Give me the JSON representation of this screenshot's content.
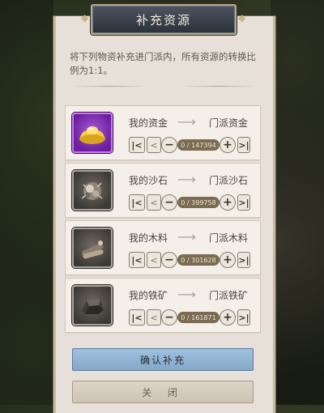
{
  "dialog": {
    "title": "补充资源",
    "description": "将下列物资补充进门派内，所有资源的转换比例为1:1。"
  },
  "resources": [
    {
      "from": "我的资金",
      "to": "门派资金",
      "value": "0 / 147394",
      "icon": "gold-ingot-icon"
    },
    {
      "from": "我的沙石",
      "to": "门派沙石",
      "value": "0 / 399758",
      "icon": "sand-stone-icon"
    },
    {
      "from": "我的木料",
      "to": "门派木料",
      "value": "0 / 301628",
      "icon": "wood-logs-icon"
    },
    {
      "from": "我的铁矿",
      "to": "门派铁矿",
      "value": "0 / 161871",
      "icon": "iron-ore-icon"
    }
  ],
  "buttons": {
    "confirm": "确认补充",
    "close": "关 闭"
  },
  "glyphs": {
    "first": "|<",
    "prev": "<",
    "minus": "−",
    "plus": "+",
    "last": ">|",
    "arrow": "⟶"
  },
  "colors": {
    "accent": "#86a8c8",
    "panel": "#e7e0d8",
    "gold_bg": "#6d1e9e"
  }
}
